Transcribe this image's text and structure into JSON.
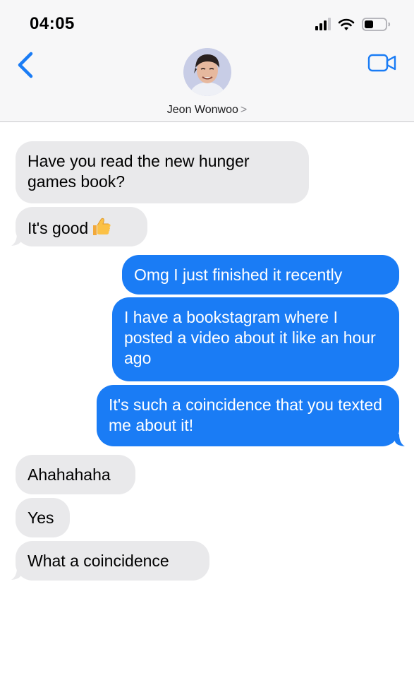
{
  "status_bar": {
    "time": "04:05"
  },
  "header": {
    "contact_name": "Jeon Wonwoo",
    "chevron": ">",
    "icons": {
      "back": "chevron-left-icon",
      "video": "video-camera-icon",
      "avatar": "contact-photo"
    }
  },
  "messages": [
    {
      "from": "contact",
      "text": "Have you read the new hunger games book?"
    },
    {
      "from": "contact",
      "text": "It's good",
      "emoji": "thumbs-up"
    },
    {
      "from": "me",
      "text": "Omg I just finished it recently"
    },
    {
      "from": "me",
      "text": "I have a bookstagram where I posted a video about it like an hour ago"
    },
    {
      "from": "me",
      "text": "It's such a coincidence that you texted me about it!"
    },
    {
      "from": "contact",
      "text": "Ahahahaha"
    },
    {
      "from": "contact",
      "text": "Yes"
    },
    {
      "from": "contact",
      "text": "What a coincidence"
    }
  ],
  "colors": {
    "sent_bubble": "#1a7cf5",
    "received_bubble": "#e9e9eb",
    "accent": "#1a7cf5"
  }
}
